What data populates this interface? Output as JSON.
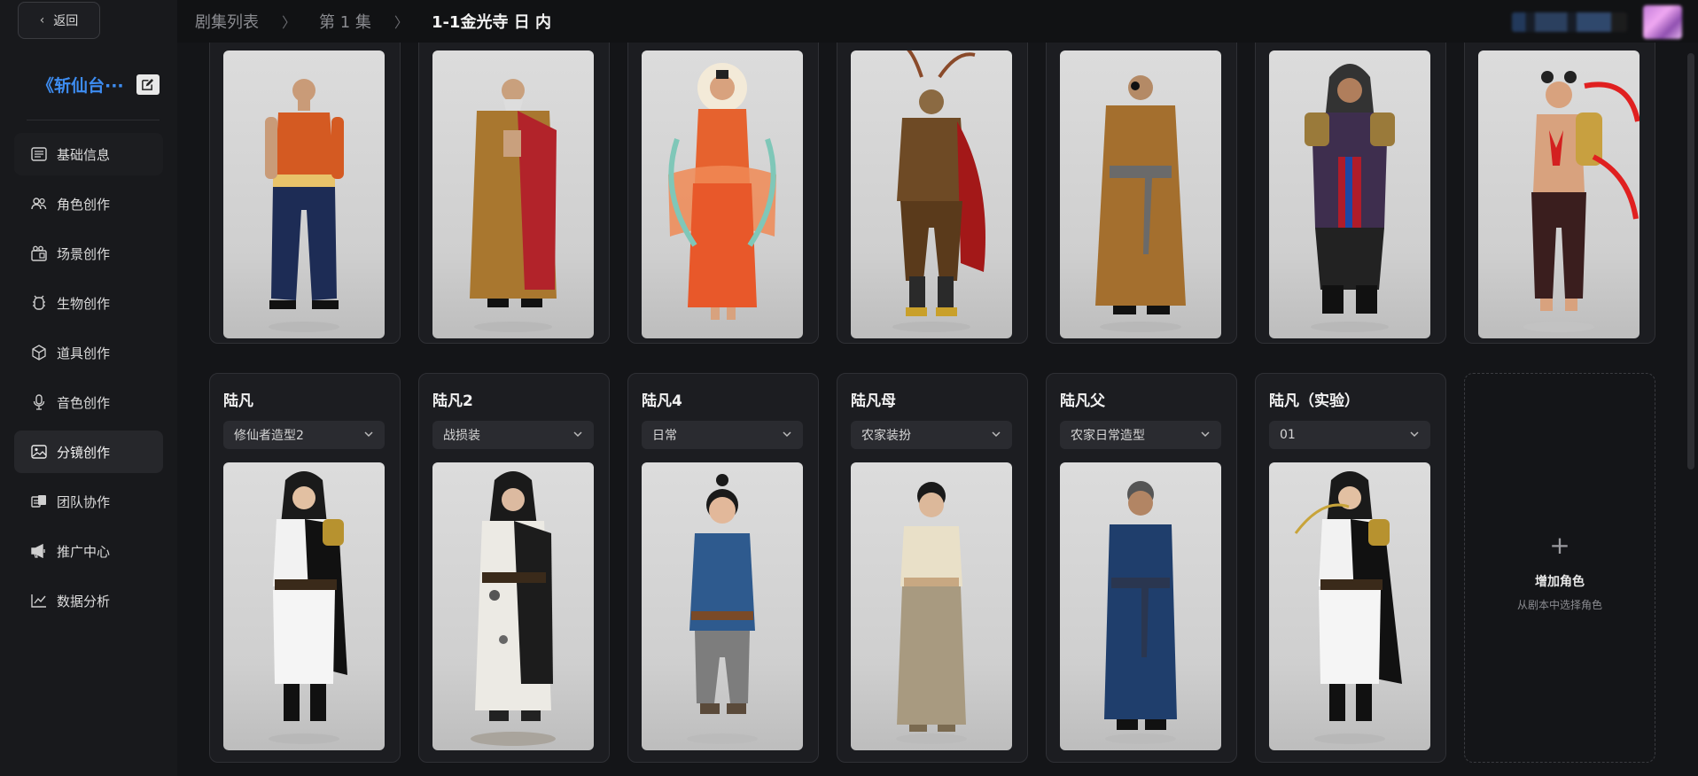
{
  "sidebar": {
    "back_label": "返回",
    "project_title": "《斩仙台···",
    "items": [
      {
        "label": "基础信息",
        "icon": "list-icon"
      },
      {
        "label": "角色创作",
        "icon": "users-icon"
      },
      {
        "label": "场景创作",
        "icon": "scene-icon"
      },
      {
        "label": "生物创作",
        "icon": "creature-icon"
      },
      {
        "label": "道具创作",
        "icon": "cube-icon"
      },
      {
        "label": "音色创作",
        "icon": "mic-icon"
      },
      {
        "label": "分镜创作",
        "icon": "image-icon"
      },
      {
        "label": "团队协作",
        "icon": "team-icon"
      },
      {
        "label": "推广中心",
        "icon": "megaphone-icon"
      },
      {
        "label": "数据分析",
        "icon": "chart-icon"
      }
    ],
    "active_index": 6
  },
  "breadcrumb": {
    "items": [
      "剧集列表",
      "第 1 集"
    ],
    "current": "1-1金光寺 日 内"
  },
  "characters_row2": [
    {
      "name": "陆凡",
      "outfit": "修仙者造型2"
    },
    {
      "name": "陆凡2",
      "outfit": "战损装"
    },
    {
      "name": "陆凡4",
      "outfit": "日常"
    },
    {
      "name": "陆凡母",
      "outfit": "农家装扮"
    },
    {
      "name": "陆凡父",
      "outfit": "农家日常造型"
    },
    {
      "name": "陆凡（实验）",
      "outfit": "01"
    }
  ],
  "add_card": {
    "plus": "+",
    "title": "增加角色",
    "subtitle": "从剧本中选择角色"
  },
  "colors": {
    "accent": "#3d8cf0",
    "background": "#141518",
    "card": "#1c1d21"
  }
}
